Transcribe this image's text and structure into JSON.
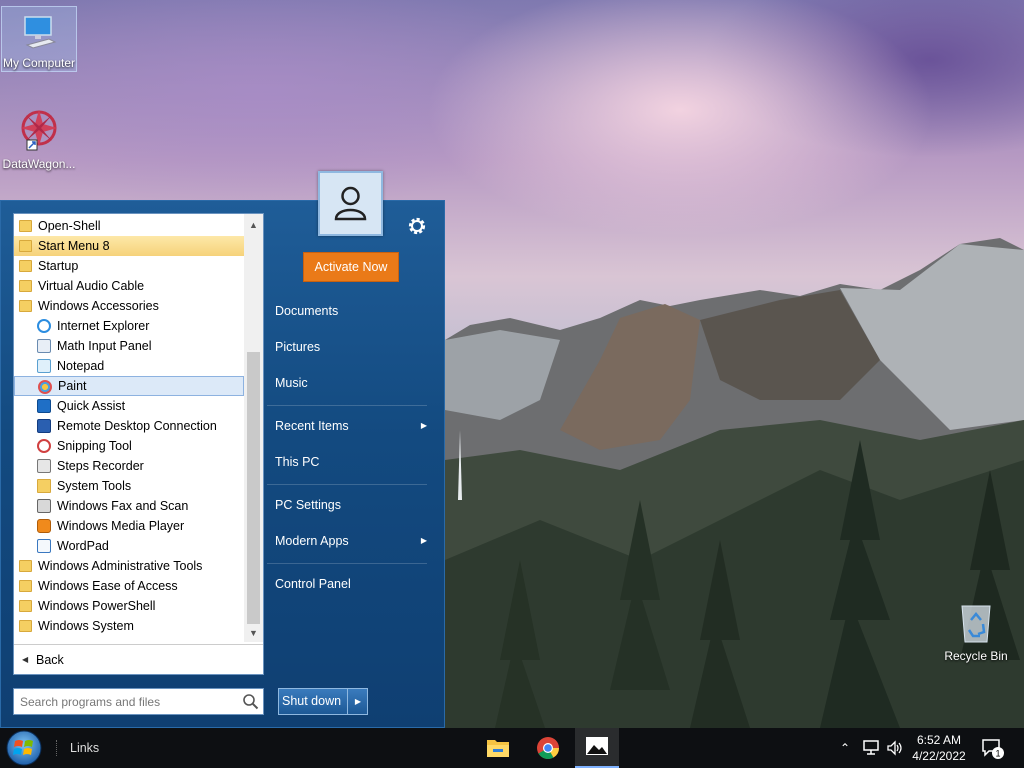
{
  "desktop": {
    "icons": [
      {
        "label": "My Computer"
      },
      {
        "label": "DataWagon..."
      },
      {
        "label": "Recycle Bin"
      }
    ]
  },
  "start_menu": {
    "programs": [
      {
        "label": "Open-Shell",
        "type": "folder"
      },
      {
        "label": "Start Menu 8",
        "type": "folder",
        "state": "highlighted"
      },
      {
        "label": "Startup",
        "type": "folder"
      },
      {
        "label": "Virtual Audio Cable",
        "type": "folder"
      },
      {
        "label": "Windows Accessories",
        "type": "folder"
      },
      {
        "label": "Internet Explorer",
        "type": "app",
        "icon": "internet-explorer-icon"
      },
      {
        "label": "Math Input Panel",
        "type": "app",
        "icon": "math-input-icon"
      },
      {
        "label": "Notepad",
        "type": "app",
        "icon": "notepad-icon"
      },
      {
        "label": "Paint",
        "type": "app",
        "icon": "paint-icon",
        "state": "selected"
      },
      {
        "label": "Quick Assist",
        "type": "app",
        "icon": "quick-assist-icon"
      },
      {
        "label": "Remote Desktop Connection",
        "type": "app",
        "icon": "remote-desktop-icon"
      },
      {
        "label": "Snipping Tool",
        "type": "app",
        "icon": "snipping-tool-icon"
      },
      {
        "label": "Steps Recorder",
        "type": "app",
        "icon": "steps-recorder-icon"
      },
      {
        "label": "System Tools",
        "type": "subfolder",
        "icon": "folder-icon"
      },
      {
        "label": "Windows Fax and Scan",
        "type": "app",
        "icon": "fax-scan-icon"
      },
      {
        "label": "Windows Media Player",
        "type": "app",
        "icon": "media-player-icon"
      },
      {
        "label": "WordPad",
        "type": "app",
        "icon": "wordpad-icon"
      },
      {
        "label": "Windows Administrative Tools",
        "type": "folder"
      },
      {
        "label": "Windows Ease of Access",
        "type": "folder"
      },
      {
        "label": "Windows PowerShell",
        "type": "folder"
      },
      {
        "label": "Windows System",
        "type": "folder"
      }
    ],
    "back_label": "Back",
    "search_placeholder": "Search programs and files",
    "activate_label": "Activate Now",
    "right_items": [
      {
        "label": "Documents"
      },
      {
        "label": "Pictures"
      },
      {
        "label": "Music"
      },
      {
        "label": "Recent Items",
        "submenu": true
      },
      {
        "label": "This PC"
      },
      {
        "label": "PC Settings"
      },
      {
        "label": "Modern Apps",
        "submenu": true
      },
      {
        "label": "Control Panel"
      }
    ],
    "shutdown_label": "Shut down"
  },
  "taskbar": {
    "links_label": "Links",
    "pinned": [
      {
        "name": "file-explorer-icon"
      },
      {
        "name": "chrome-icon"
      },
      {
        "name": "photos-icon",
        "active": true
      }
    ],
    "clock_time": "6:52 AM",
    "clock_date": "4/22/2022",
    "notification_count": "1"
  },
  "colors": {
    "start_menu_bg": "#134a80",
    "activate_button": "#ea7a18",
    "highlight": "#f6d27a",
    "taskbar": "#0d0f12"
  }
}
